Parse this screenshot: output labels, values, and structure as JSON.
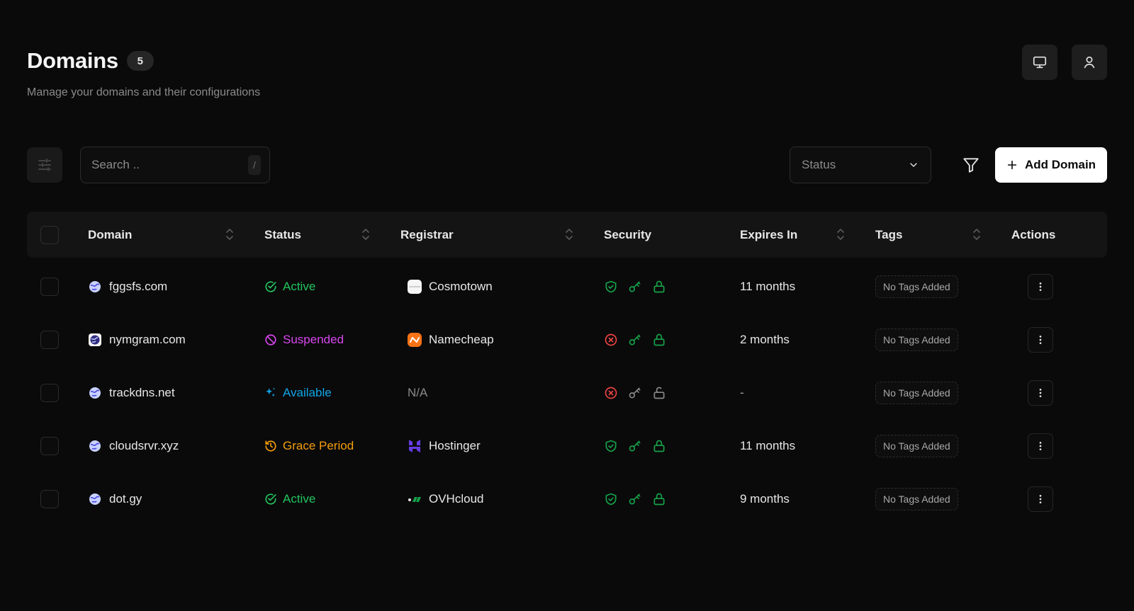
{
  "page": {
    "title": "Domains",
    "count": "5",
    "subtitle": "Manage your domains and their configurations"
  },
  "top_actions": [
    "monitor-icon",
    "user-icon"
  ],
  "toolbar": {
    "search_placeholder": "Search ..",
    "search_shortcut": "/",
    "status_select": "Status",
    "add_button": "Add Domain"
  },
  "table": {
    "columns": [
      "Domain",
      "Status",
      "Registrar",
      "Security",
      "Expires In",
      "Tags",
      "Actions"
    ],
    "rows": [
      {
        "domain": "fggsfs.com",
        "status": "Active",
        "registrar": "Cosmotown",
        "security": [
          "ok",
          "ok",
          "ok"
        ],
        "expires": "11 months",
        "tags": "No Tags Added"
      },
      {
        "domain": "nymgram.com",
        "status": "Suspended",
        "registrar": "Namecheap",
        "security": [
          "error",
          "ok",
          "ok"
        ],
        "expires": "2 months",
        "tags": "No Tags Added"
      },
      {
        "domain": "trackdns.net",
        "status": "Available",
        "registrar": "N/A",
        "security": [
          "error",
          "muted",
          "muted"
        ],
        "expires": "-",
        "tags": "No Tags Added"
      },
      {
        "domain": "cloudsrvr.xyz",
        "status": "Grace Period",
        "registrar": "Hostinger",
        "security": [
          "ok",
          "ok",
          "ok"
        ],
        "expires": "11 months",
        "tags": "No Tags Added"
      },
      {
        "domain": "dot.gy",
        "status": "Active",
        "registrar": "OVHcloud",
        "security": [
          "ok",
          "ok",
          "ok"
        ],
        "expires": "9 months",
        "tags": "No Tags Added"
      }
    ]
  },
  "colors": {
    "active": "#22c55e",
    "suspended": "#d946ef",
    "available": "#0ea5e9",
    "grace": "#f59e0b",
    "error": "#ef4444",
    "ok": "#16a34a",
    "muted": "#8a8a8a"
  }
}
